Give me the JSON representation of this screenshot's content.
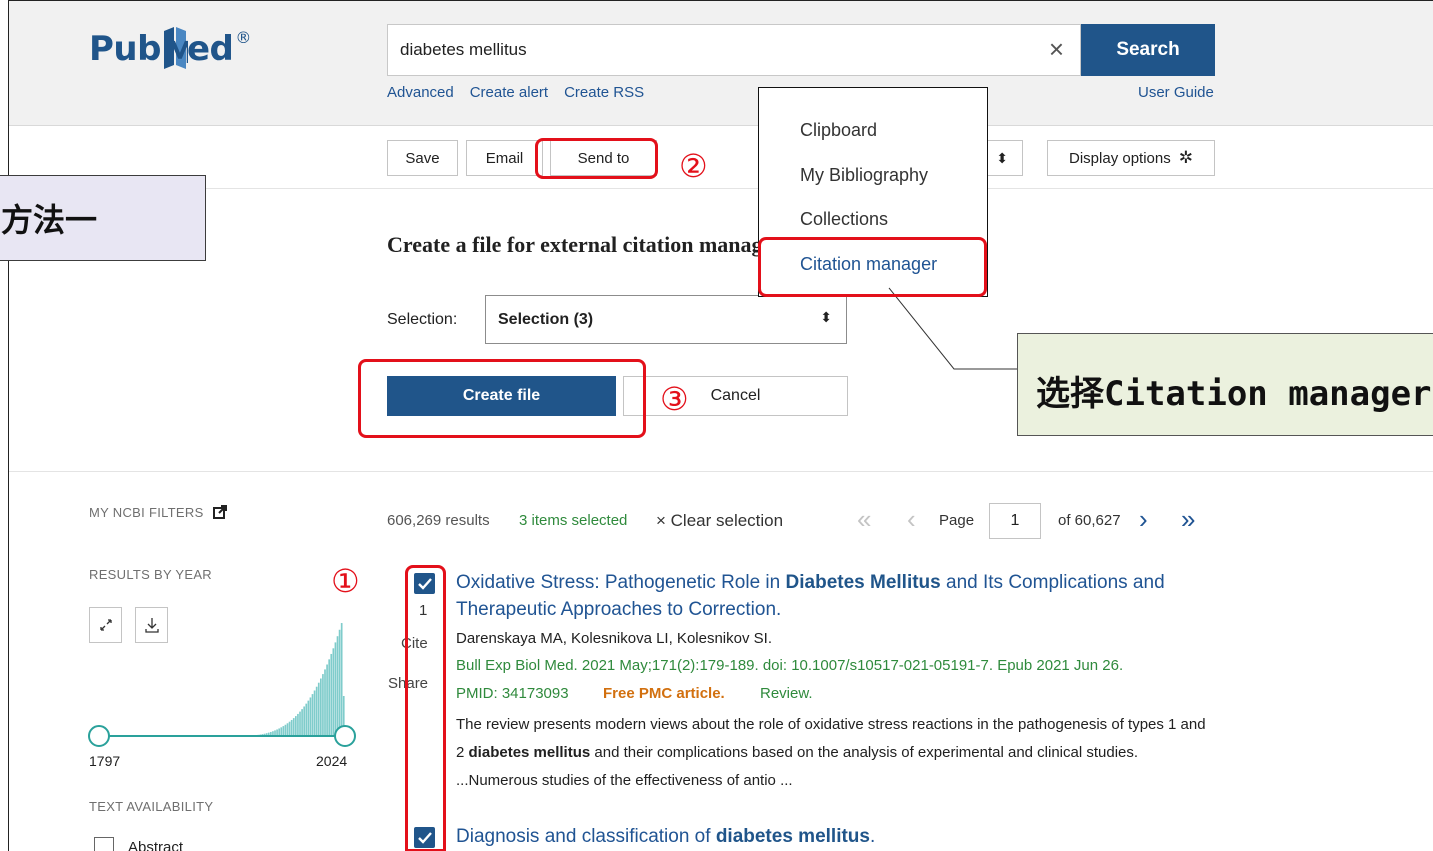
{
  "header": {
    "logo_text_left": "Pub",
    "logo_text_right": "ed",
    "logo_registered": "®",
    "search_value": "diabetes mellitus",
    "clear_icon": "×",
    "search_button": "Search",
    "links": [
      "Advanced",
      "Create alert",
      "Create RSS"
    ],
    "user_guide": "User Guide"
  },
  "toolbar": {
    "save": "Save",
    "email": "Email",
    "send_to": "Send to",
    "sort_arrow": "⬍",
    "display_options": "Display options",
    "gear_icon": "✲"
  },
  "send_to_menu": {
    "options": [
      "Clipboard",
      "My Bibliography",
      "Collections",
      "Citation manager"
    ],
    "active": "Citation manager"
  },
  "annotation": {
    "method": "方法一",
    "steps": [
      "①",
      "②",
      "③"
    ],
    "callout": "选择Citation manager"
  },
  "panel": {
    "title": "Create a file for external citation manager",
    "selection_label": "Selection:",
    "selection_value": "Selection (3)",
    "create_file": "Create file",
    "cancel": "Cancel"
  },
  "sidebar": {
    "my_ncbi_filters": "MY NCBI FILTERS",
    "results_by_year": "RESULTS BY YEAR",
    "year_start": "1797",
    "year_end": "2024",
    "text_availability": "TEXT AVAILABILITY",
    "abstract": "Abstract"
  },
  "results": {
    "count": "606,269 results",
    "selected": "3 items selected",
    "clear_selection": "× Clear selection",
    "page_label": "Page",
    "page_value": "1",
    "of_pages": "of 60,627",
    "items": [
      {
        "number": "1",
        "cite": "Cite",
        "share": "Share",
        "title_parts": [
          "Oxidative Stress: Pathogenetic Role in ",
          "Diabetes Mellitus",
          " and Its Complications and Therapeutic Approaches to Correction."
        ],
        "authors": "Darenskaya MA, Kolesnikova LI, Kolesnikov SI.",
        "journal": "Bull Exp Biol Med. 2021 May;171(2):179-189. doi: 10.1007/s10517-021-05191-7. Epub 2021 Jun 26.",
        "pmid": "PMID: 34173093",
        "free": "Free PMC article.",
        "type": "Review.",
        "snippet_parts": [
          "The review presents modern views about the role of oxidative stress reactions in the pathogenesis of types 1 and 2 ",
          "diabetes mellitus",
          " and their complications based on the analysis of experimental and clinical studies. ...Numerous studies of the effectiveness of antio ..."
        ]
      },
      {
        "title_parts": [
          "Diagnosis and classification of ",
          "diabetes mellitus",
          "."
        ]
      }
    ]
  }
}
